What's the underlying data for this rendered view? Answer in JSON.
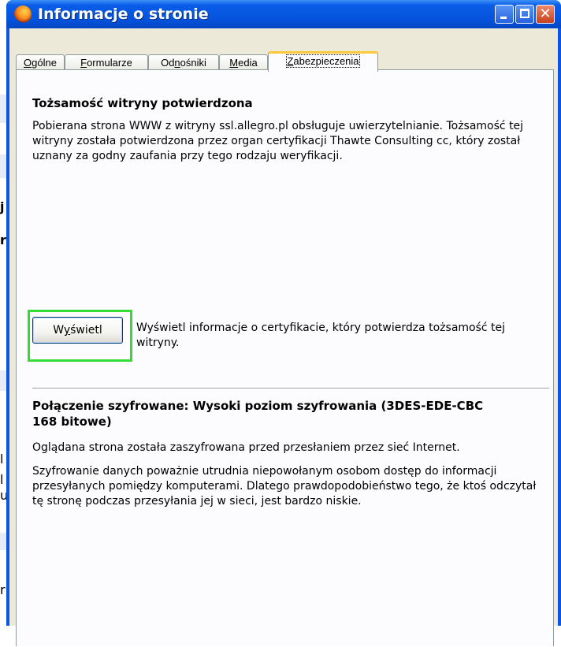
{
  "window": {
    "title": "Informacje o stronie"
  },
  "title_buttons": {
    "close_glyph": "✕"
  },
  "tabs": [
    {
      "label": "Ogólne",
      "accel": "O"
    },
    {
      "label": "Formularze",
      "accel": "F"
    },
    {
      "label": "Odnośniki",
      "accel": "n"
    },
    {
      "label": "Media",
      "accel": "M"
    },
    {
      "label": "Zabezpieczenia",
      "accel": "Z"
    }
  ],
  "active_tab": "Zabezpieczenia",
  "identity": {
    "heading": "Tożsamość witryny potwierdzona",
    "description": "Pobierana strona WWW z witryny ssl.allegro.pl obsługuje uwierzytelnianie. Tożsamość tej witryny została potwierdzona przez organ certyfikacji Thawte Consulting cc, który został uznany za godny zaufania przy tego rodzaju weryfikacji.",
    "view_button": "Wyświetl",
    "view_description": "Wyświetl informacje o certyfikacie, który potwierdza tożsamość tej witryny."
  },
  "encryption": {
    "heading": "Połączenie szyfrowane: Wysoki poziom szyfrowania (3DES-EDE-CBC 168 bitowe)",
    "paragraph1": "Oglądana strona została zaszyfrowana przed przesłaniem przez sieć Internet.",
    "paragraph2": "Szyfrowanie danych poważnie utrudnia niepowołanym osobom dostęp do informacji przesyłanych pomiędzy komputerami. Dlatego prawdopodobieństwo tego, że ktoś odczytał tę stronę podczas przesyłania jej w sieci, jest bardzo niskie."
  },
  "colors": {
    "highlight": "#33dd33",
    "titlebar": "#0553dc",
    "dialog_bg": "#ece9d8"
  },
  "background_page": {
    "fragments": [
      "j",
      "r",
      "l",
      "l",
      "u",
      "r"
    ]
  }
}
